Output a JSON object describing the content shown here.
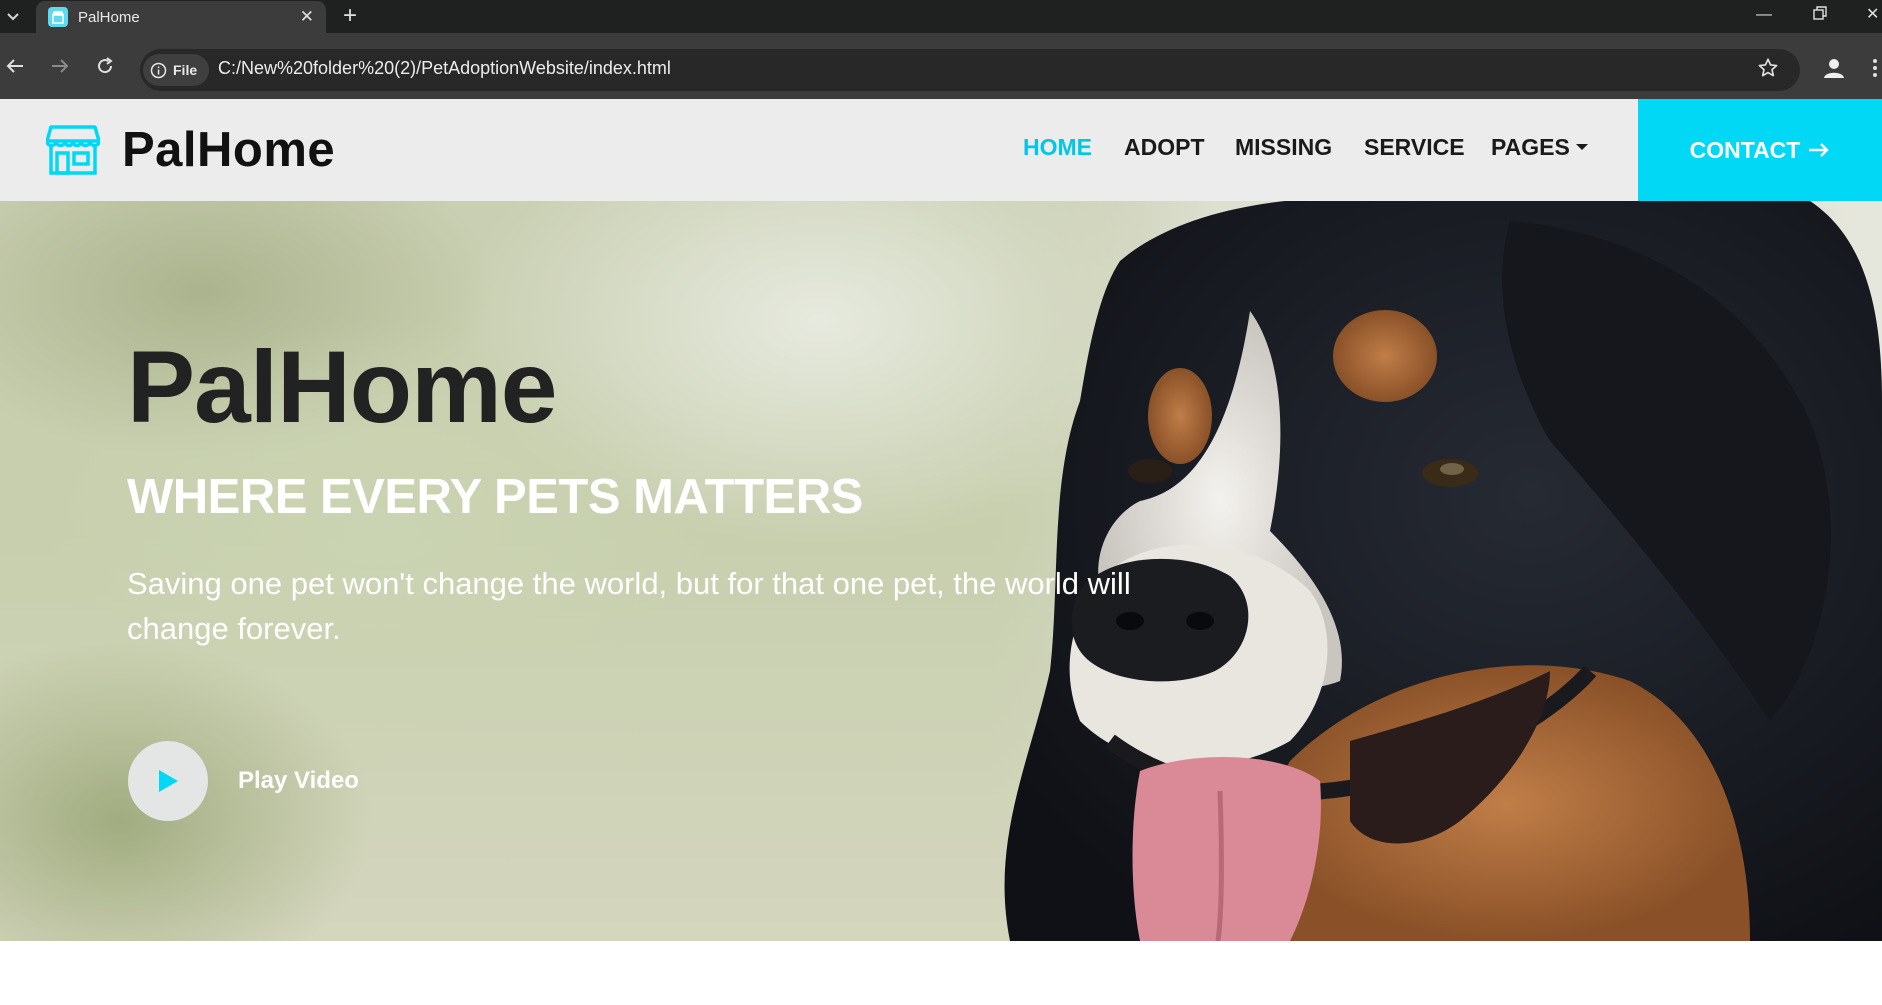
{
  "browser": {
    "tab_title": "PalHome",
    "url_chip": "File",
    "url": "C:/New%20folder%20(2)/PetAdoptionWebsite/index.html"
  },
  "site": {
    "brand": "PalHome",
    "nav": {
      "home": "HOME",
      "adopt": "ADOPT",
      "missing": "MISSING",
      "service": "SERVICE",
      "pages": "PAGES"
    },
    "contact": "CONTACT",
    "accent_color": "#00d8f5"
  },
  "hero": {
    "title": "PalHome",
    "subtitle": "WHERE EVERY PETS MATTERS",
    "text": "Saving one pet won't change the world, but for that one pet, the world will change forever.",
    "play_label": "Play Video"
  }
}
